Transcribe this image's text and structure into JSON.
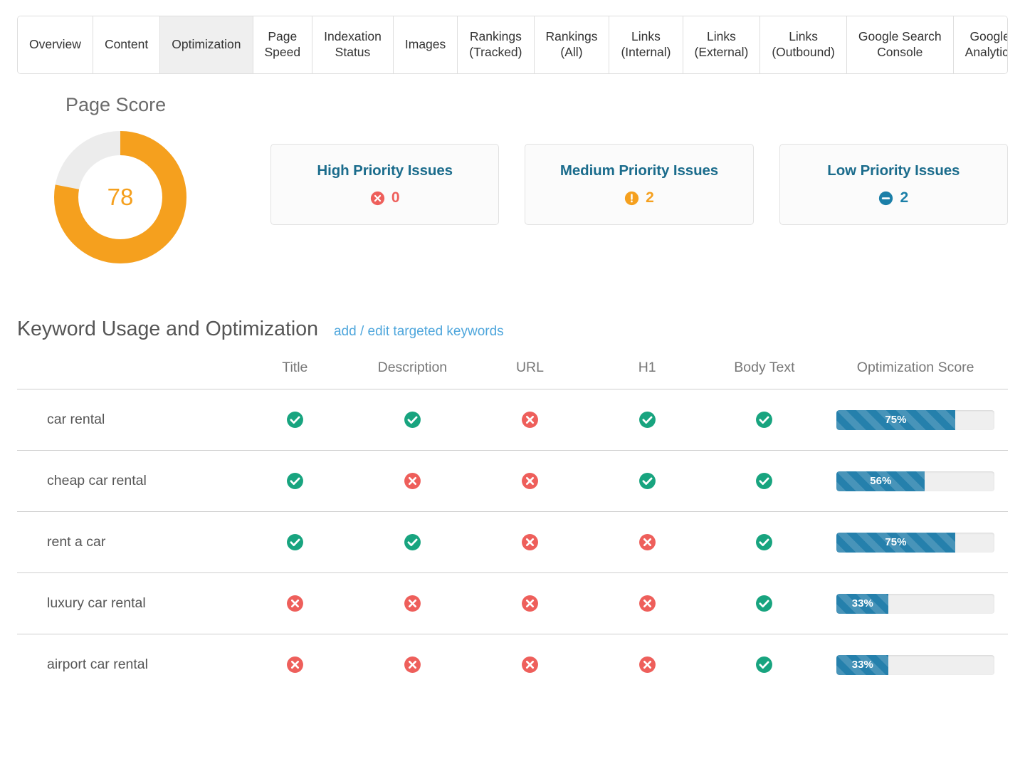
{
  "tabs": [
    {
      "label": "Overview",
      "active": false
    },
    {
      "label": "Content",
      "active": false
    },
    {
      "label": "Optimization",
      "active": true
    },
    {
      "label": "Page\nSpeed",
      "active": false
    },
    {
      "label": "Indexation\nStatus",
      "active": false
    },
    {
      "label": "Images",
      "active": false
    },
    {
      "label": "Rankings\n(Tracked)",
      "active": false
    },
    {
      "label": "Rankings\n(All)",
      "active": false
    },
    {
      "label": "Links\n(Internal)",
      "active": false
    },
    {
      "label": "Links\n(External)",
      "active": false
    },
    {
      "label": "Links\n(Outbound)",
      "active": false
    },
    {
      "label": "Google Search\nConsole",
      "active": false
    },
    {
      "label": "Google\nAnalytics",
      "active": false
    }
  ],
  "page_score": {
    "title": "Page Score",
    "value": "78",
    "percent": 78,
    "ring_color": "#F5A01E",
    "track_color": "#ececec"
  },
  "issue_cards": [
    {
      "title": "High Priority Issues",
      "count": "0",
      "icon": "times-circle-icon",
      "tone": "red",
      "color": "#EE5F5B"
    },
    {
      "title": "Medium Priority Issues",
      "count": "2",
      "icon": "exclamation-circle-icon",
      "tone": "orange",
      "color": "#F5A01E"
    },
    {
      "title": "Low Priority Issues",
      "count": "2",
      "icon": "minus-circle-icon",
      "tone": "blue",
      "color": "#1B7FA8"
    }
  ],
  "keyword_section": {
    "title": "Keyword Usage and Optimization",
    "link_label": "add / edit targeted keywords",
    "link_color": "#4EA6DC",
    "columns": [
      "",
      "Title",
      "Description",
      "URL",
      "H1",
      "Body Text",
      "Optimization Score"
    ],
    "rows": [
      {
        "keyword": "car rental",
        "title": true,
        "description": true,
        "url": false,
        "h1": true,
        "body": true,
        "score": 75,
        "score_label": "75%"
      },
      {
        "keyword": "cheap car rental",
        "title": true,
        "description": false,
        "url": false,
        "h1": true,
        "body": true,
        "score": 56,
        "score_label": "56%"
      },
      {
        "keyword": "rent a car",
        "title": true,
        "description": true,
        "url": false,
        "h1": false,
        "body": true,
        "score": 75,
        "score_label": "75%"
      },
      {
        "keyword": "luxury car rental",
        "title": false,
        "description": false,
        "url": false,
        "h1": false,
        "body": true,
        "score": 33,
        "score_label": "33%"
      },
      {
        "keyword": "airport car rental",
        "title": false,
        "description": false,
        "url": false,
        "h1": false,
        "body": true,
        "score": 33,
        "score_label": "33%"
      }
    ],
    "icons": {
      "pass": "check-circle-icon",
      "fail": "times-circle-icon"
    },
    "pass_color": "#18A47F",
    "fail_color": "#EE5F5B",
    "bar_color": "#2580AC",
    "bar_track_color": "#efefef"
  }
}
